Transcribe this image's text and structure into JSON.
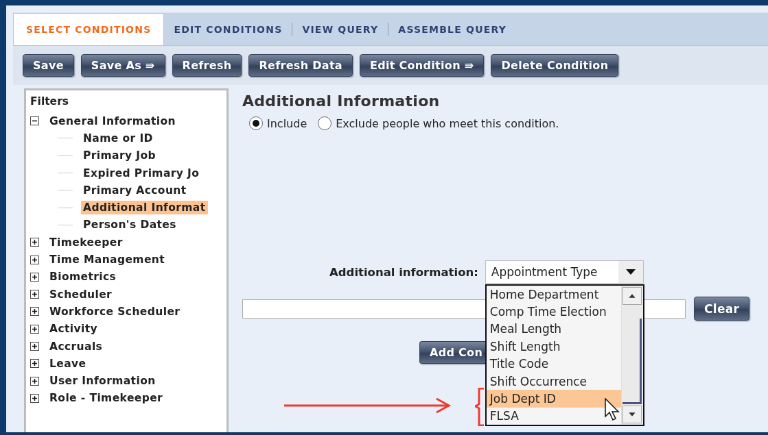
{
  "tabs": [
    {
      "label": "SELECT CONDITIONS",
      "selected": true
    },
    {
      "label": "EDIT CONDITIONS",
      "selected": false
    },
    {
      "label": "VIEW QUERY",
      "selected": false
    },
    {
      "label": "ASSEMBLE QUERY",
      "selected": false
    }
  ],
  "toolbar": [
    "Save",
    "Save As ⇛",
    "Refresh",
    "Refresh Data",
    "Edit Condition ⇛",
    "Delete Condition"
  ],
  "filters": {
    "title": "Filters",
    "items": [
      {
        "label": "General Information",
        "expanded": true,
        "children": [
          {
            "label": "Name or ID",
            "selected": false
          },
          {
            "label": "Primary Job",
            "selected": false
          },
          {
            "label": "Expired Primary Jo",
            "selected": false
          },
          {
            "label": "Primary Account",
            "selected": false
          },
          {
            "label": "Additional Informat",
            "selected": true
          },
          {
            "label": "Person's Dates",
            "selected": false
          }
        ]
      },
      {
        "label": "Timekeeper",
        "expanded": false
      },
      {
        "label": "Time Management",
        "expanded": false
      },
      {
        "label": "Biometrics",
        "expanded": false
      },
      {
        "label": "Scheduler",
        "expanded": false
      },
      {
        "label": "Workforce Scheduler",
        "expanded": false
      },
      {
        "label": "Activity",
        "expanded": false
      },
      {
        "label": "Accruals",
        "expanded": false
      },
      {
        "label": "Leave",
        "expanded": false
      },
      {
        "label": "User Information",
        "expanded": false
      },
      {
        "label": "Role - Timekeeper",
        "expanded": false
      }
    ]
  },
  "condition": {
    "title": "Additional Information",
    "options": [
      {
        "label": "Include",
        "selected": true
      },
      {
        "label": "Exclude people who meet this condition.",
        "selected": false
      }
    ],
    "field_label": "Additional information:",
    "select_value": "Appointment Type",
    "dropdown": [
      {
        "label": "Home Department",
        "selected": false
      },
      {
        "label": "Comp Time Election",
        "selected": false
      },
      {
        "label": "Meal Length",
        "selected": false
      },
      {
        "label": "Shift Length",
        "selected": false
      },
      {
        "label": "Title Code",
        "selected": false
      },
      {
        "label": "Shift Occurrence",
        "selected": false
      },
      {
        "label": "Job Dept ID",
        "selected": true
      },
      {
        "label": "FLSA",
        "selected": false
      }
    ],
    "clear_button": "Clear",
    "add_button": "Add Con"
  }
}
